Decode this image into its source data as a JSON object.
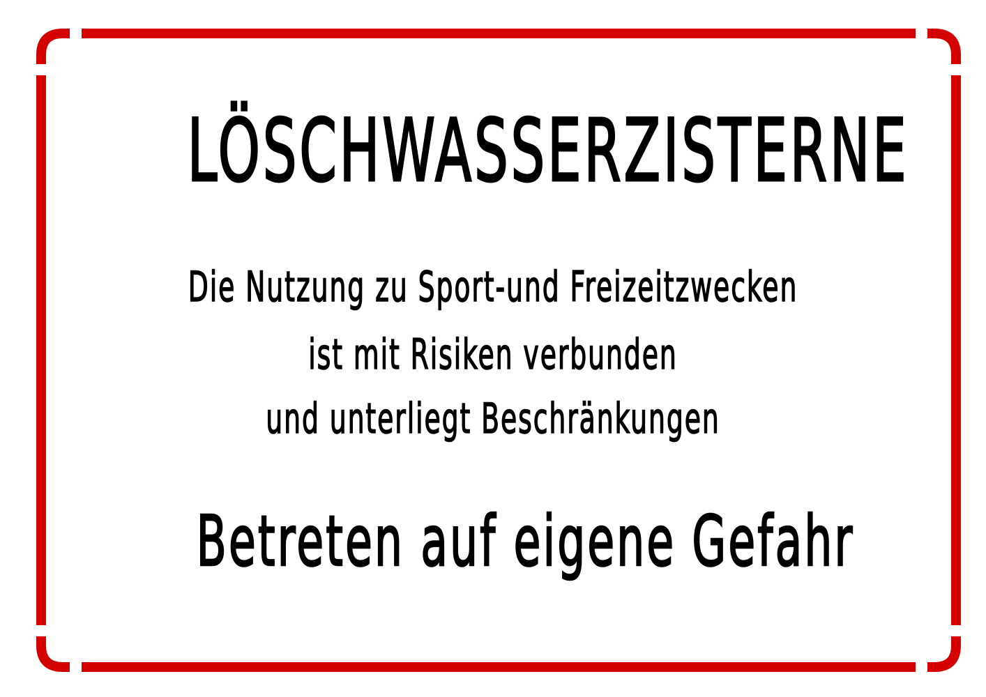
{
  "sign": {
    "title": "LÖSCHWASSERZISTERNE",
    "body_lines": [
      "Die Nutzung zu Sport-und Freizeitzwecken",
      "ist mit Risiken verbunden",
      "und unterliegt Beschränkungen"
    ],
    "warning": "Betreten auf eigene Gefahr"
  },
  "colors": {
    "border": "#d40000",
    "text": "#000000",
    "background": "#ffffff"
  }
}
